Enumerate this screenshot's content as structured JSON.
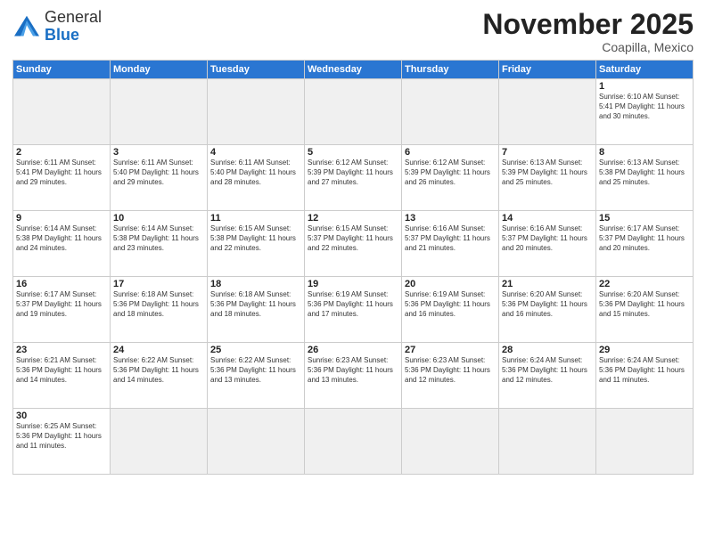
{
  "header": {
    "logo_general": "General",
    "logo_blue": "Blue",
    "month_title": "November 2025",
    "subtitle": "Coapilla, Mexico"
  },
  "days_of_week": [
    "Sunday",
    "Monday",
    "Tuesday",
    "Wednesday",
    "Thursday",
    "Friday",
    "Saturday"
  ],
  "weeks": [
    [
      {
        "day": "",
        "info": "",
        "empty": true
      },
      {
        "day": "",
        "info": "",
        "empty": true
      },
      {
        "day": "",
        "info": "",
        "empty": true
      },
      {
        "day": "",
        "info": "",
        "empty": true
      },
      {
        "day": "",
        "info": "",
        "empty": true
      },
      {
        "day": "",
        "info": "",
        "empty": true
      },
      {
        "day": "1",
        "info": "Sunrise: 6:10 AM\nSunset: 5:41 PM\nDaylight: 11 hours\nand 30 minutes."
      }
    ],
    [
      {
        "day": "2",
        "info": "Sunrise: 6:11 AM\nSunset: 5:41 PM\nDaylight: 11 hours\nand 29 minutes."
      },
      {
        "day": "3",
        "info": "Sunrise: 6:11 AM\nSunset: 5:40 PM\nDaylight: 11 hours\nand 29 minutes."
      },
      {
        "day": "4",
        "info": "Sunrise: 6:11 AM\nSunset: 5:40 PM\nDaylight: 11 hours\nand 28 minutes."
      },
      {
        "day": "5",
        "info": "Sunrise: 6:12 AM\nSunset: 5:39 PM\nDaylight: 11 hours\nand 27 minutes."
      },
      {
        "day": "6",
        "info": "Sunrise: 6:12 AM\nSunset: 5:39 PM\nDaylight: 11 hours\nand 26 minutes."
      },
      {
        "day": "7",
        "info": "Sunrise: 6:13 AM\nSunset: 5:39 PM\nDaylight: 11 hours\nand 25 minutes."
      },
      {
        "day": "8",
        "info": "Sunrise: 6:13 AM\nSunset: 5:38 PM\nDaylight: 11 hours\nand 25 minutes."
      }
    ],
    [
      {
        "day": "9",
        "info": "Sunrise: 6:14 AM\nSunset: 5:38 PM\nDaylight: 11 hours\nand 24 minutes."
      },
      {
        "day": "10",
        "info": "Sunrise: 6:14 AM\nSunset: 5:38 PM\nDaylight: 11 hours\nand 23 minutes."
      },
      {
        "day": "11",
        "info": "Sunrise: 6:15 AM\nSunset: 5:38 PM\nDaylight: 11 hours\nand 22 minutes."
      },
      {
        "day": "12",
        "info": "Sunrise: 6:15 AM\nSunset: 5:37 PM\nDaylight: 11 hours\nand 22 minutes."
      },
      {
        "day": "13",
        "info": "Sunrise: 6:16 AM\nSunset: 5:37 PM\nDaylight: 11 hours\nand 21 minutes."
      },
      {
        "day": "14",
        "info": "Sunrise: 6:16 AM\nSunset: 5:37 PM\nDaylight: 11 hours\nand 20 minutes."
      },
      {
        "day": "15",
        "info": "Sunrise: 6:17 AM\nSunset: 5:37 PM\nDaylight: 11 hours\nand 20 minutes."
      }
    ],
    [
      {
        "day": "16",
        "info": "Sunrise: 6:17 AM\nSunset: 5:37 PM\nDaylight: 11 hours\nand 19 minutes."
      },
      {
        "day": "17",
        "info": "Sunrise: 6:18 AM\nSunset: 5:36 PM\nDaylight: 11 hours\nand 18 minutes."
      },
      {
        "day": "18",
        "info": "Sunrise: 6:18 AM\nSunset: 5:36 PM\nDaylight: 11 hours\nand 18 minutes."
      },
      {
        "day": "19",
        "info": "Sunrise: 6:19 AM\nSunset: 5:36 PM\nDaylight: 11 hours\nand 17 minutes."
      },
      {
        "day": "20",
        "info": "Sunrise: 6:19 AM\nSunset: 5:36 PM\nDaylight: 11 hours\nand 16 minutes."
      },
      {
        "day": "21",
        "info": "Sunrise: 6:20 AM\nSunset: 5:36 PM\nDaylight: 11 hours\nand 16 minutes."
      },
      {
        "day": "22",
        "info": "Sunrise: 6:20 AM\nSunset: 5:36 PM\nDaylight: 11 hours\nand 15 minutes."
      }
    ],
    [
      {
        "day": "23",
        "info": "Sunrise: 6:21 AM\nSunset: 5:36 PM\nDaylight: 11 hours\nand 14 minutes."
      },
      {
        "day": "24",
        "info": "Sunrise: 6:22 AM\nSunset: 5:36 PM\nDaylight: 11 hours\nand 14 minutes."
      },
      {
        "day": "25",
        "info": "Sunrise: 6:22 AM\nSunset: 5:36 PM\nDaylight: 11 hours\nand 13 minutes."
      },
      {
        "day": "26",
        "info": "Sunrise: 6:23 AM\nSunset: 5:36 PM\nDaylight: 11 hours\nand 13 minutes."
      },
      {
        "day": "27",
        "info": "Sunrise: 6:23 AM\nSunset: 5:36 PM\nDaylight: 11 hours\nand 12 minutes."
      },
      {
        "day": "28",
        "info": "Sunrise: 6:24 AM\nSunset: 5:36 PM\nDaylight: 11 hours\nand 12 minutes."
      },
      {
        "day": "29",
        "info": "Sunrise: 6:24 AM\nSunset: 5:36 PM\nDaylight: 11 hours\nand 11 minutes."
      }
    ],
    [
      {
        "day": "30",
        "info": "Sunrise: 6:25 AM\nSunset: 5:36 PM\nDaylight: 11 hours\nand 11 minutes."
      },
      {
        "day": "",
        "info": "",
        "empty": true
      },
      {
        "day": "",
        "info": "",
        "empty": true
      },
      {
        "day": "",
        "info": "",
        "empty": true
      },
      {
        "day": "",
        "info": "",
        "empty": true
      },
      {
        "day": "",
        "info": "",
        "empty": true
      },
      {
        "day": "",
        "info": "",
        "empty": true
      }
    ]
  ]
}
